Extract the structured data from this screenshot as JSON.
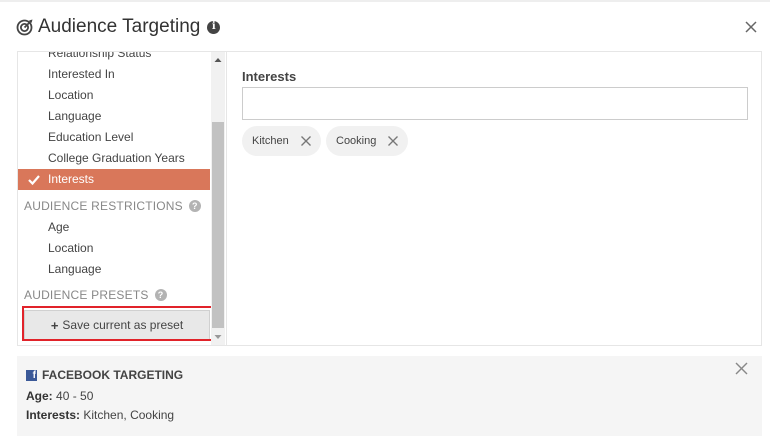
{
  "modal": {
    "title": "Audience Targeting"
  },
  "sidebar": {
    "items": [
      {
        "label": "Relationship Status"
      },
      {
        "label": "Interested In"
      },
      {
        "label": "Location"
      },
      {
        "label": "Language"
      },
      {
        "label": "Education Level"
      },
      {
        "label": "College Graduation Years"
      },
      {
        "label": "Interests",
        "active": true
      }
    ],
    "restrictions_heading": "AUDIENCE RESTRICTIONS",
    "restrictions": [
      {
        "label": "Age"
      },
      {
        "label": "Location"
      },
      {
        "label": "Language"
      }
    ],
    "presets_heading": "AUDIENCE PRESETS",
    "save_preset_label": "Save current as preset"
  },
  "main": {
    "field_label": "Interests",
    "input_value": "",
    "tags": [
      "Kitchen",
      "Cooking"
    ]
  },
  "facebook": {
    "heading": "FACEBOOK TARGETING",
    "age_label": "Age:",
    "age_value": "40 - 50",
    "interests_label": "Interests:",
    "interests_value": "Kitchen, Cooking"
  },
  "colors": {
    "active_item": "#d9775a",
    "highlight": "#e1232a",
    "facebook_blue": "#3b5998"
  },
  "icons": {
    "title_icon": "bullseye-icon",
    "info": "info-icon",
    "close": "close-icon",
    "help": "question-icon",
    "check": "check-icon",
    "plus": "plus-icon",
    "facebook": "facebook-icon"
  }
}
